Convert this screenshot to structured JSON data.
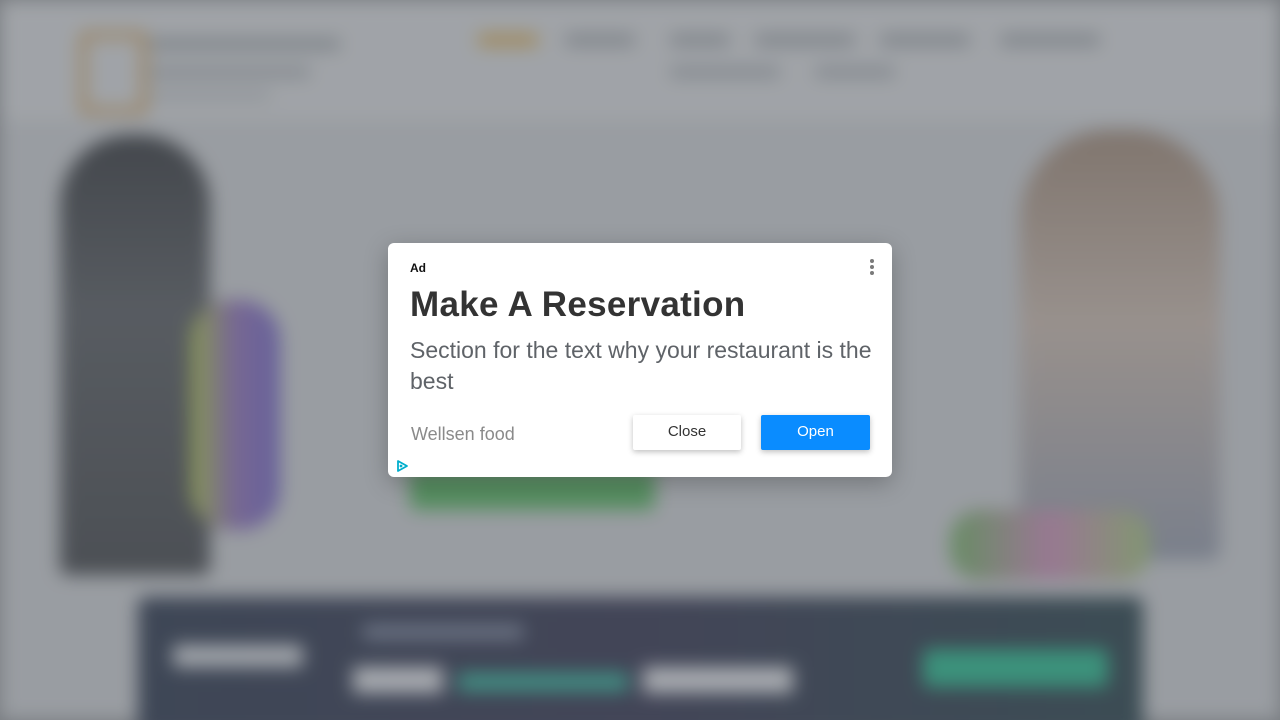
{
  "ad": {
    "label": "Ad",
    "headline": "Make A Reservation",
    "body": "Section for the text why your restaurant is the best",
    "advertiser": "Wellsen food",
    "close_label": "Close",
    "open_label": "Open",
    "icons": {
      "menu": "more-vert-icon",
      "adchoices": "adchoices-icon"
    }
  },
  "colors": {
    "open_button": "#0a8cff",
    "adchoices": "#00aecd",
    "headline": "#333333"
  }
}
